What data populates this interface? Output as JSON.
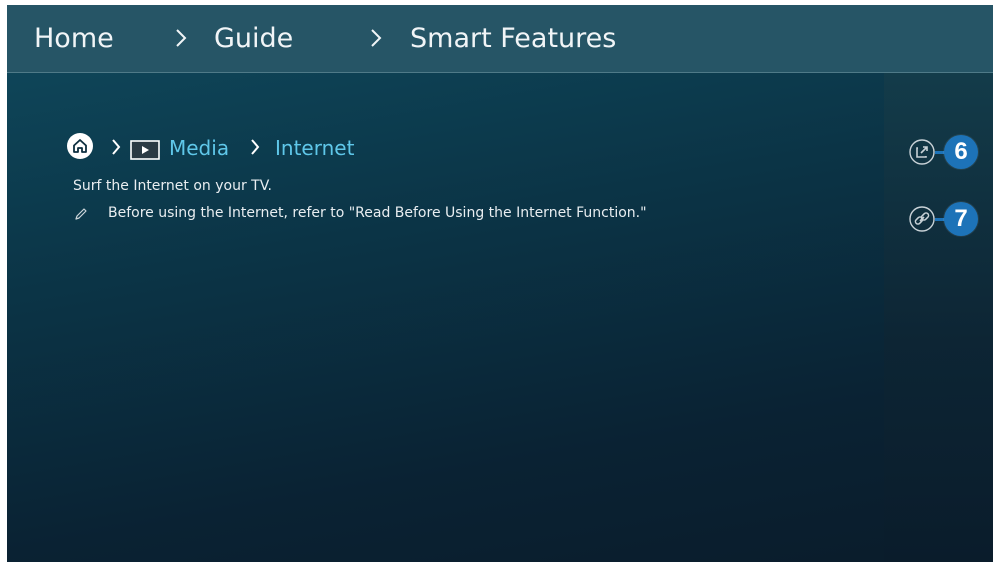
{
  "breadcrumb": {
    "items": [
      "Home",
      "Guide",
      "Smart Features"
    ]
  },
  "path": {
    "media": "Media",
    "internet": "Internet"
  },
  "content": {
    "description": "Surf the Internet on your TV.",
    "note": "Before using the Internet, refer to \"Read Before Using the Internet Function.\""
  },
  "callouts": {
    "badge_6": "6",
    "badge_7": "7"
  },
  "colors": {
    "accent": "#5fc7e9",
    "badge": "#1d73b8",
    "topbar": "#265566"
  },
  "icons": {
    "home": "home-icon",
    "media": "media-play-icon",
    "pencil": "pencil-icon",
    "open_external": "open-external-icon",
    "link": "link-icon"
  }
}
